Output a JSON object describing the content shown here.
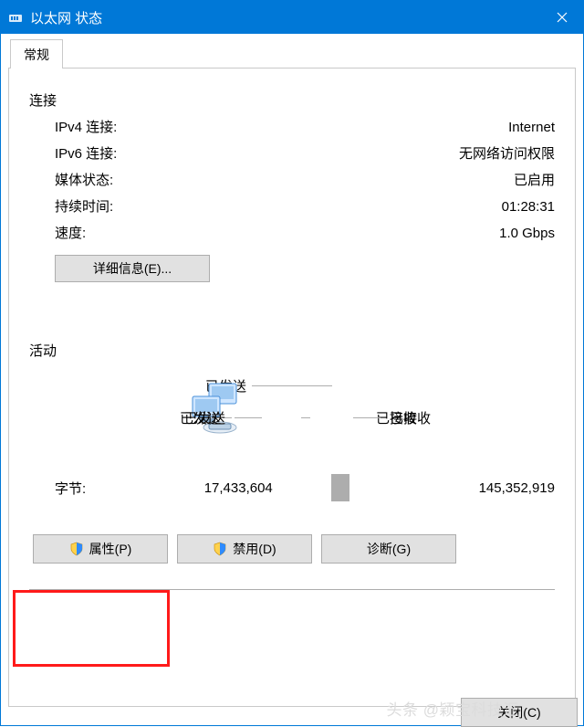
{
  "window": {
    "title": "以太网 状态",
    "tab_label": "常规",
    "close_label": "关闭(C)"
  },
  "connection": {
    "section": "连接",
    "ipv4_label": "IPv4 连接:",
    "ipv4_value": "Internet",
    "ipv6_label": "IPv6 连接:",
    "ipv6_value": "无网络访问权限",
    "media_label": "媒体状态:",
    "media_value": "已启用",
    "duration_label": "持续时间:",
    "duration_value": "01:28:31",
    "speed_label": "速度:",
    "speed_value": "1.0 Gbps",
    "details_button": "详细信息(E)..."
  },
  "activity": {
    "section": "活动",
    "sent_label": "已发送",
    "received_label": "已接收",
    "bytes_label": "字节:",
    "bytes_sent": "17,433,604",
    "bytes_received": "145,352,919"
  },
  "buttons": {
    "properties": "属性(P)",
    "disable": "禁用(D)",
    "diagnose": "诊断(G)"
  },
  "watermark": "头条 @颖宝科技汇"
}
